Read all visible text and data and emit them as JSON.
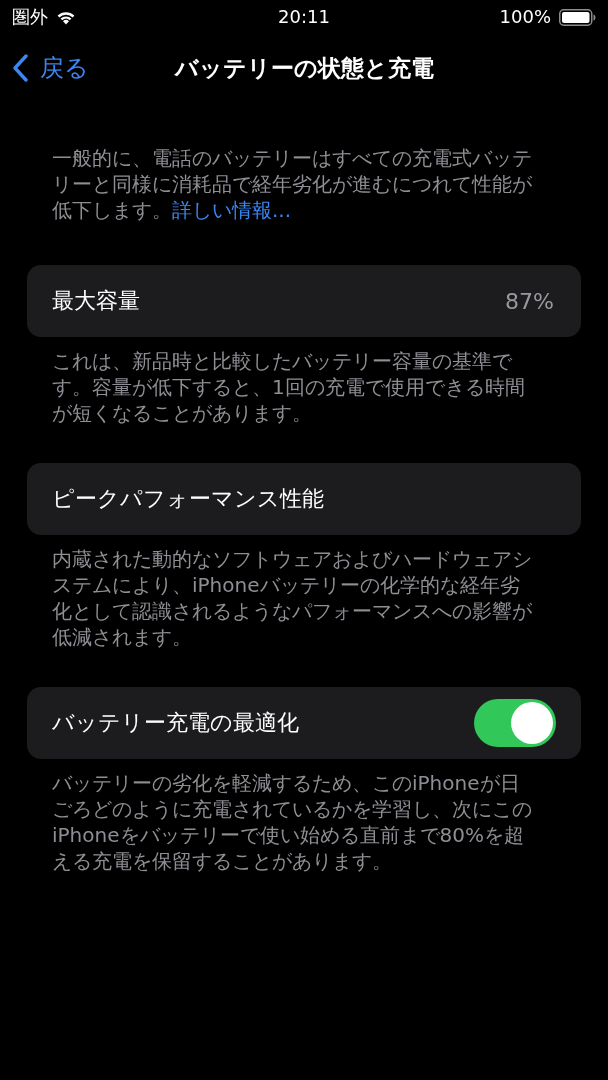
{
  "status_bar": {
    "carrier": "圏外",
    "time": "20:11",
    "battery_percent": "100%"
  },
  "nav_bar": {
    "back": "戻る",
    "title": "バッテリーの状態と充電"
  },
  "intro": {
    "text": "一般的に、電話のバッテリーはすべての充電式バッテリーと同様に消耗品で経年劣化が進むにつれて性能が低下します。",
    "link": "詳しい情報..."
  },
  "sections": [
    {
      "kind": "value",
      "label": "最大容量",
      "value": "87%",
      "footer": "これは、新品時と比較したバッテリー容量の基準です。容量が低下すると、1回の充電で使用できる時間が短くなることがあります。"
    },
    {
      "kind": "plain",
      "label": "ピークパフォーマンス性能",
      "footer": "内蔵された動的なソフトウェアおよびハードウェアシステムにより、iPhoneバッテリーの化学的な経年劣化として認識されるようなパフォーマンスへの影響が低減されます。"
    },
    {
      "kind": "toggle",
      "label": "バッテリー充電の最適化",
      "on": true,
      "footer": "バッテリーの劣化を軽減するため、このiPhoneが日ごろどのように充電されているかを学習し、次にこのiPhoneをバッテリーで使い始める直前まで80%を超える充電を保留することがあります。"
    }
  ]
}
